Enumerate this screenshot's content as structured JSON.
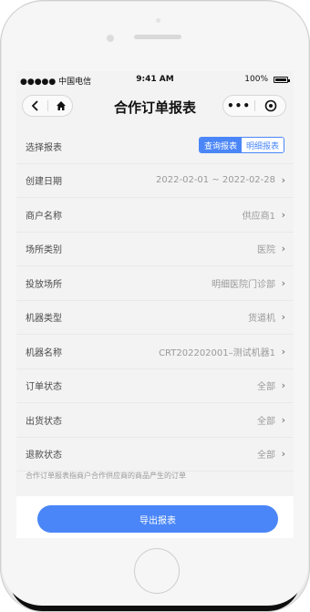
{
  "status": {
    "carrier": "●●●●● 中国电信 ",
    "time": "9:41 AM",
    "battery": "100%"
  },
  "nav": {
    "title": "合作订单报表",
    "more_label": "•••"
  },
  "report_selector": {
    "label": "选择报表",
    "options": [
      "查询报表",
      "明细报表"
    ],
    "selected": "查询报表"
  },
  "fields": [
    {
      "label": "创建日期",
      "value": "2022-02-01 ~ 2022-02-28"
    },
    {
      "label": "商户名称",
      "value": "供应商1"
    },
    {
      "label": "场所类别",
      "value": "医院"
    },
    {
      "label": "投放场所",
      "value": "明细医院门诊部"
    },
    {
      "label": "机器类型",
      "value": "货道机"
    },
    {
      "label": "机器名称",
      "value": "CRT202202001–测试机器1"
    },
    {
      "label": "订单状态",
      "value": "全部"
    },
    {
      "label": "出货状态",
      "value": "全部"
    },
    {
      "label": "退款状态",
      "value": "全部"
    }
  ],
  "hint": "合作订单报表指商户合作供应商的商品产生的订单",
  "export_button": "导出报表",
  "chevron": "›",
  "colors": {
    "accent": "#4a86f7"
  }
}
